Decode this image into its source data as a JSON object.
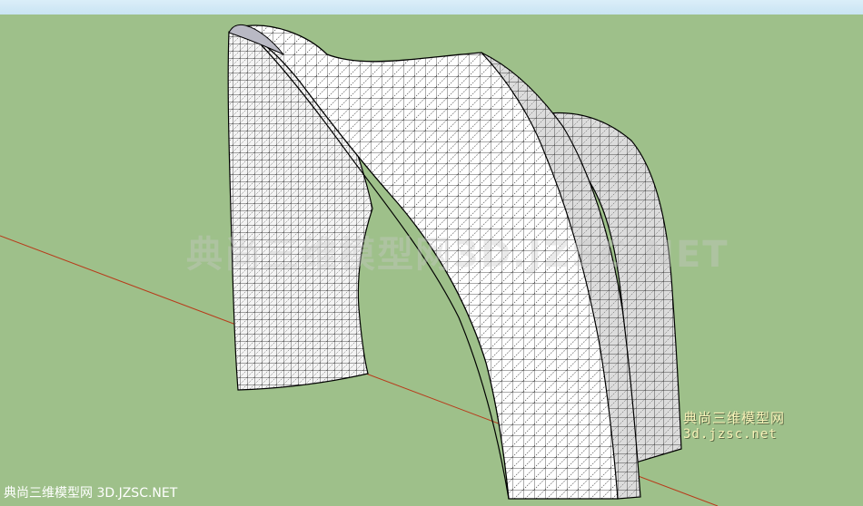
{
  "viewport": {
    "background_color": "#9ec08a",
    "sky_color": "#d3eaf7",
    "axis_color": "#b83a1a",
    "model_face_color": "#ffffff",
    "model_edge_color": "#000000"
  },
  "watermarks": {
    "center_text": "典尚三维模型网3D.JZSC.NET",
    "corner_line1": "典尚三维模型网",
    "corner_line2": "3d.jzsc.net",
    "bottom_text": "典尚三维模型网 3D.JZSC.NET"
  }
}
